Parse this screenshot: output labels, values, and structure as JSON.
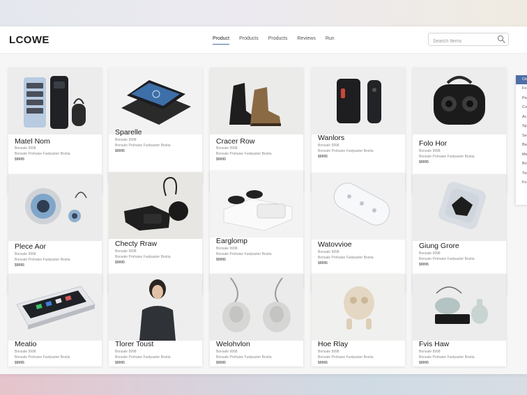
{
  "app": {
    "logo": "LCOWE"
  },
  "nav": {
    "items": [
      "Product",
      "Products",
      "Products",
      "Reviews",
      "Run"
    ]
  },
  "search": {
    "placeholder": "Search Items"
  },
  "products": [
    {
      "title": "Matel Nom",
      "sub": "Bonsale 9998",
      "desc": "Bonsale Prohaise Fuelpaster Bostia",
      "price": "$9995"
    },
    {
      "title": "Sparelle",
      "sub": "Bonsale 9998",
      "desc": "Bonsale Prohaise Fuelpaster Bostia",
      "price": "$9995"
    },
    {
      "title": "Cracer Row",
      "sub": "Bonsale 9998",
      "desc": "Bonsale Prohaise Fuelpaster Bostia",
      "price": "$9995"
    },
    {
      "title": "Wanlors",
      "sub": "Bonsale 9998",
      "desc": "Bonsale Prohaise Fuelpaster Bostia",
      "price": "$9995"
    },
    {
      "title": "Folo Hor",
      "sub": "Bonsale 9998",
      "desc": "Bonsale Prohaise Fuelpaster Bostia",
      "price": "$9995"
    },
    {
      "title": "Plece Aor",
      "sub": "Bonsale 9998",
      "desc": "Bonsale Prohaise Fuelpaster Bostia",
      "price": "$9995"
    },
    {
      "title": "Checty Rraw",
      "sub": "Bonsale 9998",
      "desc": "Bonsale Prohaise Fuelpaster Bostia",
      "price": "$9995"
    },
    {
      "title": "Earglomp",
      "sub": "Bonsale 9998",
      "desc": "Bonsale Prohaise Fuelpaster Bostia",
      "price": "$9995"
    },
    {
      "title": "Watovvioe",
      "sub": "Bonsale 9998",
      "desc": "Bonsale Prohaise Fuelpaster Bostia",
      "price": "$9995"
    },
    {
      "title": "Giung Grore",
      "sub": "Bonsale 9998",
      "desc": "Bonsale Prohaise Fuelpaster Bostia",
      "price": "$9995"
    },
    {
      "title": "Meatio",
      "sub": "Bonsale 9998",
      "desc": "Bonsale Prohaise Fuelpaster Bostia",
      "price": "$9995"
    },
    {
      "title": "Tlorer Toust",
      "sub": "Bonsale 9998",
      "desc": "Bonsale Prohaise Fuelpaster Bostia",
      "price": "$9995"
    },
    {
      "title": "Welohvlon",
      "sub": "Bonsale 9998",
      "desc": "Bonsale Prohaise Fuelpaster Bostia",
      "price": "$9995"
    },
    {
      "title": "Hoe Rlay",
      "sub": "Bonsale 9998",
      "desc": "Bonsale Prohaise Fuelpaster Bostia",
      "price": "$9995"
    },
    {
      "title": "Fvis Haw",
      "sub": "Bonsale 9998",
      "desc": "Bonsale Prohaise Fuelpaster Bostia",
      "price": "$9995"
    }
  ],
  "sidepanel": {
    "tab": "Cla",
    "options": [
      "Fo",
      "Pa",
      "Co",
      "Ac",
      "Sp",
      "Se",
      "Ba",
      "Me",
      "Bo",
      "Tw",
      "Fo"
    ]
  },
  "colors": {
    "accent": "#4d6ea6",
    "card_bg": "#ffffff",
    "page_bg": "#f6f6f7"
  }
}
